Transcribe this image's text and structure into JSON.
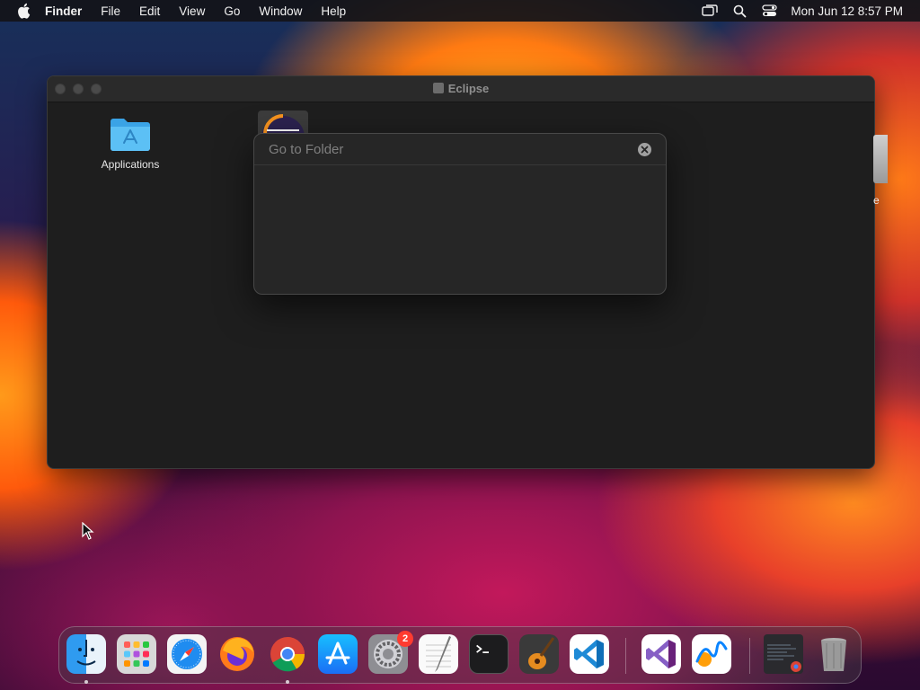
{
  "menubar": {
    "app_name": "Finder",
    "items": [
      "File",
      "Edit",
      "View",
      "Go",
      "Window",
      "Help"
    ],
    "clock": "Mon Jun 12  8:57 PM",
    "status_icons": [
      "screen-mirroring-icon",
      "spotlight-search-icon",
      "control-center-icon"
    ]
  },
  "window": {
    "title": "Eclipse",
    "items": [
      {
        "label": "Applications",
        "icon": "applications-folder-icon"
      },
      {
        "label": "",
        "icon": "eclipse-app-icon"
      }
    ]
  },
  "goto_dialog": {
    "placeholder": "Go to Folder",
    "value": ""
  },
  "desktop": {
    "partial_item_label": "e"
  },
  "dock": {
    "apps": [
      {
        "name": "Finder",
        "icon": "finder-icon",
        "running": true
      },
      {
        "name": "Launchpad",
        "icon": "launchpad-icon",
        "running": false
      },
      {
        "name": "Safari",
        "icon": "safari-icon",
        "running": false
      },
      {
        "name": "Firefox",
        "icon": "firefox-icon",
        "running": false
      },
      {
        "name": "Google Chrome",
        "icon": "chrome-icon",
        "running": true
      },
      {
        "name": "App Store",
        "icon": "app-store-icon",
        "running": false
      },
      {
        "name": "System Settings",
        "icon": "system-settings-icon",
        "running": false,
        "badge": "2"
      },
      {
        "name": "TextEdit",
        "icon": "textedit-icon",
        "running": false
      },
      {
        "name": "Terminal",
        "icon": "terminal-icon",
        "running": false
      },
      {
        "name": "GarageBand",
        "icon": "garageband-icon",
        "running": false
      },
      {
        "name": "Visual Studio Code",
        "icon": "vscode-icon",
        "running": false
      },
      {
        "name": "Visual Studio",
        "icon": "visual-studio-icon",
        "running": false
      },
      {
        "name": "Freeform",
        "icon": "freeform-icon",
        "running": false
      },
      {
        "name": "Chrome window",
        "icon": "minimized-window-icon",
        "running": false
      },
      {
        "name": "Trash",
        "icon": "trash-icon",
        "running": false
      }
    ]
  },
  "colors": {
    "menubar_bg": "#141418",
    "window_bg": "#1e1e1e",
    "dialog_bg": "#262626",
    "badge": "#ff3b30"
  }
}
